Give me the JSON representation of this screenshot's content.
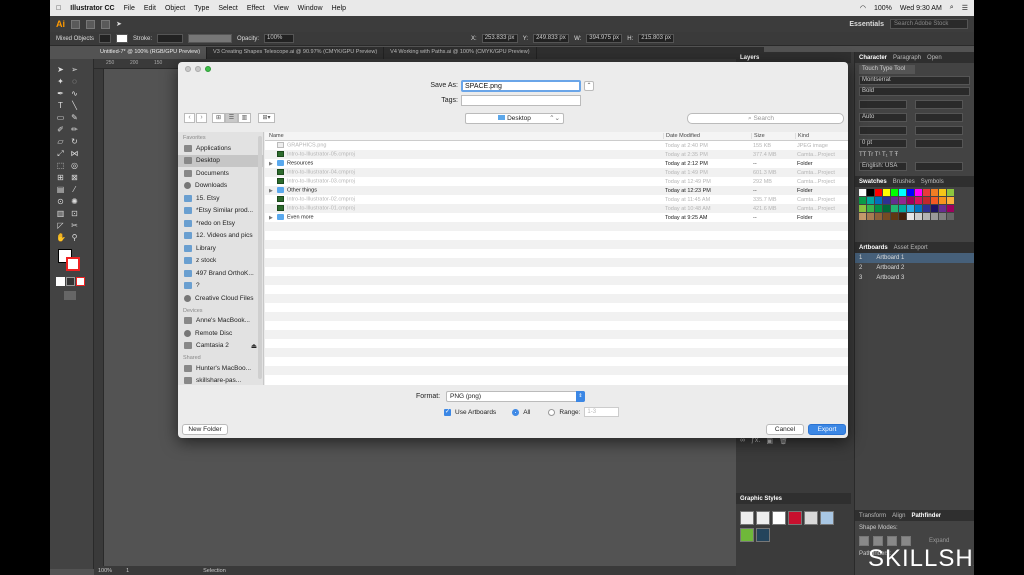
{
  "menubar": {
    "app_name": "Illustrator CC",
    "items": [
      "File",
      "Edit",
      "Object",
      "Type",
      "Select",
      "Effect",
      "View",
      "Window",
      "Help"
    ],
    "battery": "100%",
    "clock": "Wed 9:30 AM"
  },
  "ai_topbar": {
    "logo": "Ai",
    "workspace": "Essentials",
    "search_placeholder": "Search Adobe Stock"
  },
  "control_bar": {
    "selection": "Mixed Objects",
    "stroke_label": "Stroke:",
    "opacity_label": "Opacity:",
    "opacity_value": "100%",
    "x_value": "253.833 px",
    "y_value": "249.833 px",
    "w_value": "394.975 px",
    "h_value": "215.803 px"
  },
  "doc_tabs": [
    "Untitled-7* @ 100% (RGB/GPU Preview)",
    "V3 Creating Shapes Telescope.ai @ 90.97% (CMYK/GPU Preview)",
    "V4 Working with Paths.ai @ 100% (CMYK/GPU Preview)"
  ],
  "status_bar": {
    "zoom": "100%",
    "page": "1",
    "tool": "Selection"
  },
  "ruler": {
    "marks": [
      "250",
      "200",
      "150"
    ]
  },
  "panels": {
    "layers_tab": "Layers",
    "character_tabs": [
      "Character",
      "Paragraph",
      "Open"
    ],
    "touch_type": "Touch Type Tool",
    "font_family": "Montserrat",
    "font_style": "Bold",
    "language": "English: USA",
    "kern": "Auto",
    "tracking": "0 pt",
    "swatch_tabs": [
      "Swatches",
      "Brushes",
      "Symbols"
    ],
    "swatch_colors": [
      "#ffffff",
      "#000000",
      "#ff0000",
      "#ffff00",
      "#00ff00",
      "#00ffff",
      "#0000ff",
      "#ff00ff",
      "#e83a3a",
      "#f07d24",
      "#f5c518",
      "#8dc63f",
      "#0a9e4a",
      "#00a99d",
      "#0071bc",
      "#2e3192",
      "#662d91",
      "#93278f",
      "#9e005d",
      "#d4145a",
      "#c1272d",
      "#f15a24",
      "#f7931e",
      "#fbb03b",
      "#8cc63f",
      "#39b54a",
      "#009245",
      "#006837",
      "#22b573",
      "#00a99d",
      "#29abe2",
      "#0071bc",
      "#2e3192",
      "#1b1464",
      "#662d91",
      "#9e005d",
      "#c69c6d",
      "#a67c52",
      "#8c6239",
      "#754c24",
      "#603813",
      "#42210b",
      "#e6e6e6",
      "#cccccc",
      "#b3b3b3",
      "#999999",
      "#808080",
      "#666666"
    ],
    "artboard_tabs": [
      "Artboards",
      "Asset Export"
    ],
    "artboards": [
      {
        "num": "1",
        "name": "Artboard 1"
      },
      {
        "num": "2",
        "name": "Artboard 2"
      },
      {
        "num": "3",
        "name": "Artboard 3"
      }
    ],
    "graphic_styles_tab": "Graphic Styles",
    "transform_tabs": [
      "Transform",
      "Align",
      "Pathfinder"
    ],
    "shape_modes": "Shape Modes:",
    "expand_label": "Expand",
    "pathfinders_label": "Pathfinders:"
  },
  "dialog": {
    "save_as_label": "Save As:",
    "save_as_value": "SPACE.png",
    "tags_label": "Tags:",
    "location": "Desktop",
    "search_placeholder": "Search",
    "sidebar": {
      "favorites_head": "Favorites",
      "favorites": [
        "Applications",
        "Desktop",
        "Documents",
        "Downloads",
        "15. Etsy",
        "*Etsy Similar prod...",
        "*redo on Etsy",
        "12. Videos and pics",
        "Library",
        "z stock",
        "497 Brand OrthoK...",
        "?",
        "Creative Cloud Files"
      ],
      "devices_head": "Devices",
      "devices": [
        "Anne's MacBook...",
        "Remote Disc",
        "Camtasia 2"
      ],
      "shared_head": "Shared",
      "shared": [
        "Hunter's MacBoo...",
        "skillshare-pas..."
      ]
    },
    "columns": {
      "name": "Name",
      "date": "Date Modified",
      "size": "Size",
      "kind": "Kind"
    },
    "files": [
      {
        "name": "GRAPHICS.png",
        "date": "Today at 2:40 PM",
        "size": "155 KB",
        "kind": "JPEG image",
        "type": "img",
        "dim": true,
        "disclosure": ""
      },
      {
        "name": "Intro-to-Illustrator-05.cmproj",
        "date": "Today at 2:35 PM",
        "size": "377.4 MB",
        "kind": "Camta...Project",
        "type": "cam",
        "dim": true,
        "disclosure": ""
      },
      {
        "name": "Resources",
        "date": "Today at 2:12 PM",
        "size": "--",
        "kind": "Folder",
        "type": "folder",
        "dim": false,
        "disclosure": "▶"
      },
      {
        "name": "Intro-to-Illustrator-04.cmproj",
        "date": "Today at 1:49 PM",
        "size": "601.3 MB",
        "kind": "Camta...Project",
        "type": "cam",
        "dim": true,
        "disclosure": ""
      },
      {
        "name": "Intro-to-Illustrator-03.cmproj",
        "date": "Today at 12:49 PM",
        "size": "292 MB",
        "kind": "Camta...Project",
        "type": "cam",
        "dim": true,
        "disclosure": ""
      },
      {
        "name": "Other things",
        "date": "Today at 12:23 PM",
        "size": "--",
        "kind": "Folder",
        "type": "folder",
        "dim": false,
        "disclosure": "▶"
      },
      {
        "name": "Intro-to-Illustrator-02.cmproj",
        "date": "Today at 11:45 AM",
        "size": "335.7 MB",
        "kind": "Camta...Project",
        "type": "cam",
        "dim": true,
        "disclosure": ""
      },
      {
        "name": "Intro-to-Illustrator-01.cmproj",
        "date": "Today at 10:48 AM",
        "size": "421.6 MB",
        "kind": "Camta...Project",
        "type": "cam",
        "dim": true,
        "disclosure": ""
      },
      {
        "name": "Even more",
        "date": "Today at 9:25 AM",
        "size": "--",
        "kind": "Folder",
        "type": "folder",
        "dim": false,
        "disclosure": "▶"
      }
    ],
    "format_label": "Format:",
    "format_value": "PNG (png)",
    "use_artboards": "Use Artboards",
    "all_label": "All",
    "range_label": "Range:",
    "range_value": "1-3",
    "new_folder": "New Folder",
    "cancel": "Cancel",
    "export": "Export"
  },
  "watermark": "SKILLSHARE"
}
